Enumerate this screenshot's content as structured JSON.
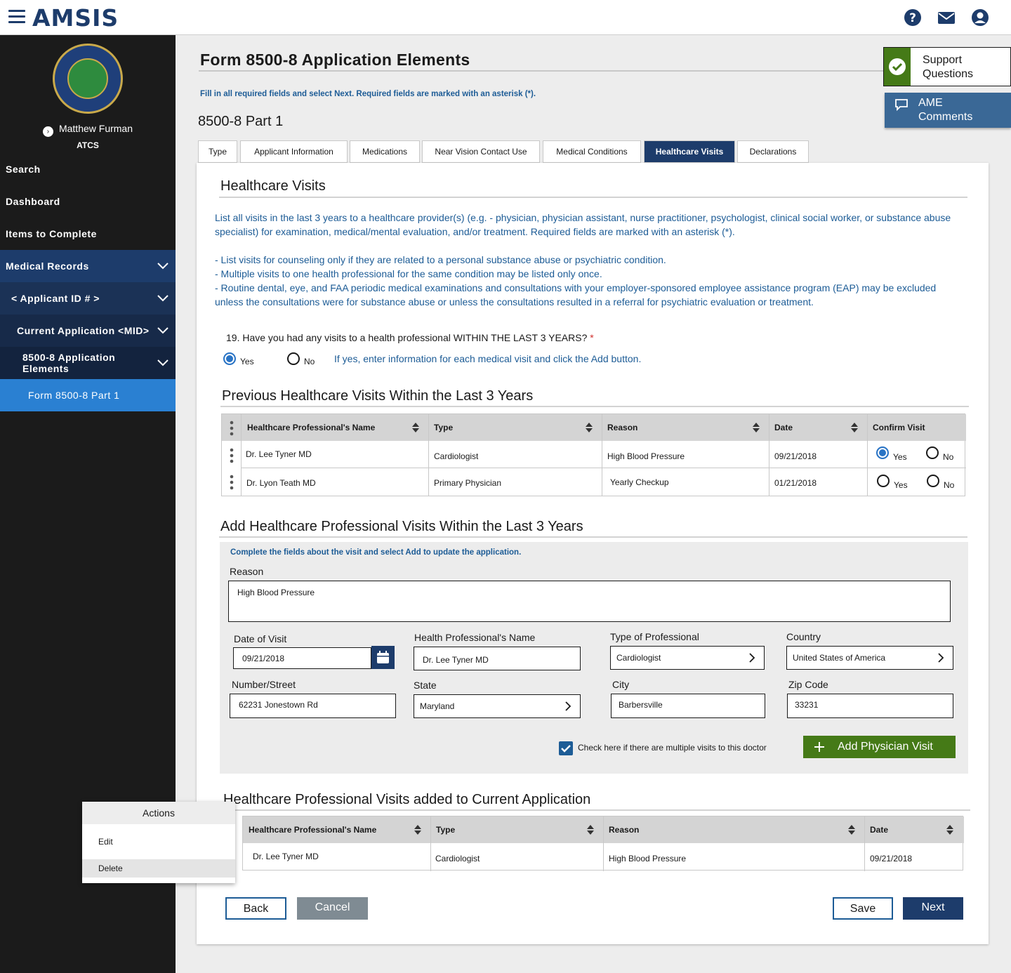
{
  "header": {
    "logo": "AMSIS",
    "icons": [
      "menu-icon",
      "help-icon",
      "mail-icon",
      "user-icon"
    ]
  },
  "sidebar": {
    "user_name": "Matthew Furman",
    "user_role": "ATCS",
    "items": [
      {
        "label": "Search"
      },
      {
        "label": "Dashboard"
      },
      {
        "label": "Items to Complete"
      },
      {
        "label": "Medical Records"
      },
      {
        "label": "< Applicant ID # >"
      },
      {
        "label": "Current Application <MID>"
      },
      {
        "label": "8500-8 Application Elements"
      },
      {
        "label": "Form 8500-8 Part 1"
      }
    ]
  },
  "page": {
    "title": "Form 8500-8 Application Elements",
    "instructions": "Fill in all required fields and select Next. Required fields are marked with an asterisk (*).",
    "part_title": "8500-8 Part 1"
  },
  "side_buttons": {
    "support": "Support Questions",
    "ame": "AME Comments"
  },
  "tabs": [
    "Type",
    "Applicant Information",
    "Medications",
    "Near Vision Contact Use",
    "Medical Conditions",
    "Healthcare Visits",
    "Declarations"
  ],
  "section": {
    "title": "Healthcare Visits",
    "intro": "List all visits in the last 3 years to a healthcare provider(s) (e.g. - physician, physician assistant, nurse practitioner, psychologist, clinical social worker, or substance abuse specialist) for examination, medical/mental evaluation, and/or treatment. Required fields are marked with an asterisk (*).",
    "bullet1": "- List visits for counseling only if they are related to a personal substance abuse or psychiatric condition.",
    "bullet2": "- Multiple visits to one health professional for the same condition may be listed only once.",
    "bullet3": "- Routine dental, eye, and FAA periodic medical examinations and consultations with your employer-sponsored employee assistance program (EAP) may be excluded unless the consultations were for substance abuse or unless the consultations resulted in a referral for psychiatric evaluation or treatment.",
    "question": "19. Have you had any visits to a health professional WITHIN THE LAST 3 YEARS?",
    "asterisk": "*",
    "yes": "Yes",
    "no": "No",
    "hint": "If yes, enter information for each medical visit and click the Add button."
  },
  "previous": {
    "title": "Previous Healthcare Visits Within the Last 3 Years",
    "headers": [
      "Healthcare Professional's Name",
      "Type",
      "Reason",
      "Date",
      "Confirm Visit"
    ],
    "rows": [
      {
        "name": "Dr. Lee Tyner MD",
        "type": "Cardiologist",
        "reason": "High Blood Pressure",
        "date": "09/21/2018",
        "yes": "Yes",
        "no": "No"
      },
      {
        "name": "Dr. Lyon Teath MD",
        "type": "Primary Physician",
        "reason": "Yearly Checkup",
        "date": "01/21/2018",
        "yes": "Yes",
        "no": "No"
      }
    ]
  },
  "add": {
    "title": "Add Healthcare Professional Visits Within the Last 3 Years",
    "instructions": "Complete the fields about the visit and select Add to update the application.",
    "reason_label": "Reason",
    "reason_value": "High Blood Pressure",
    "date_label": "Date of Visit",
    "date_value": "09/21/2018",
    "name_label": "Health Professional's Name",
    "name_value": "Dr. Lee Tyner MD",
    "type_label": "Type of Professional",
    "type_value": "Cardiologist",
    "country_label": "Country",
    "country_value": "United States of America",
    "street_label": "Number/Street",
    "street_value": "62231 Jonestown Rd",
    "state_label": "State",
    "state_value": "Maryland",
    "city_label": "City",
    "city_value": "Barbersville",
    "zip_label": "Zip Code",
    "zip_value": "33231",
    "multiple_label": "Check here if there are multiple visits to this doctor",
    "add_button": "Add Physician Visit"
  },
  "added": {
    "title": "Healthcare Professional Visits added to Current Application",
    "headers": [
      "Healthcare Professional's Name",
      "Type",
      "Reason",
      "Date"
    ],
    "rows": [
      {
        "name": "Dr. Lee Tyner MD",
        "type": "Cardiologist",
        "reason": "High Blood Pressure",
        "date": "09/21/2018"
      }
    ]
  },
  "actions_menu": {
    "title": "Actions",
    "edit": "Edit",
    "delete": "Delete"
  },
  "footer": {
    "back": "Back",
    "cancel": "Cancel",
    "save": "Save",
    "next": "Next"
  },
  "colors": {
    "navy": "#1d3c6b",
    "link_blue": "#1d5c96",
    "green": "#457a17",
    "active_sidebar": "#2a80d2",
    "sidebar_bg": "#1b1b1b"
  }
}
